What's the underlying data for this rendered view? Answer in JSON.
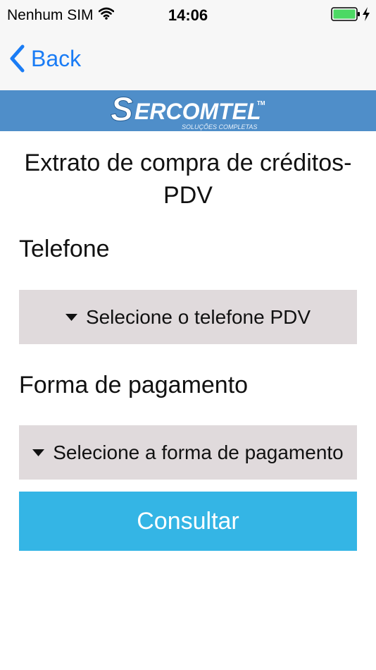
{
  "status_bar": {
    "carrier": "Nenhum SIM",
    "time": "14:06",
    "battery_color": "#4cd964"
  },
  "nav": {
    "back_label": "Back",
    "accent_color": "#1a7cf5"
  },
  "brand": {
    "name": "SERCOMTEL",
    "tagline": "SOLUÇÕES COMPLETAS",
    "trademark": "TM",
    "banner_color": "#4f8ec9"
  },
  "page": {
    "title_line1": "Extrato de compra de créditos-",
    "title_line2": "PDV"
  },
  "form": {
    "phone_label": "Telefone",
    "phone_select_value": "Selecione o telefone PDV",
    "payment_label": "Forma de pagamento",
    "payment_select_value": "Selecione a forma de pagamento",
    "submit_label": "Consultar",
    "select_bg_color": "#e0dadc",
    "submit_color": "#34b5e5"
  }
}
